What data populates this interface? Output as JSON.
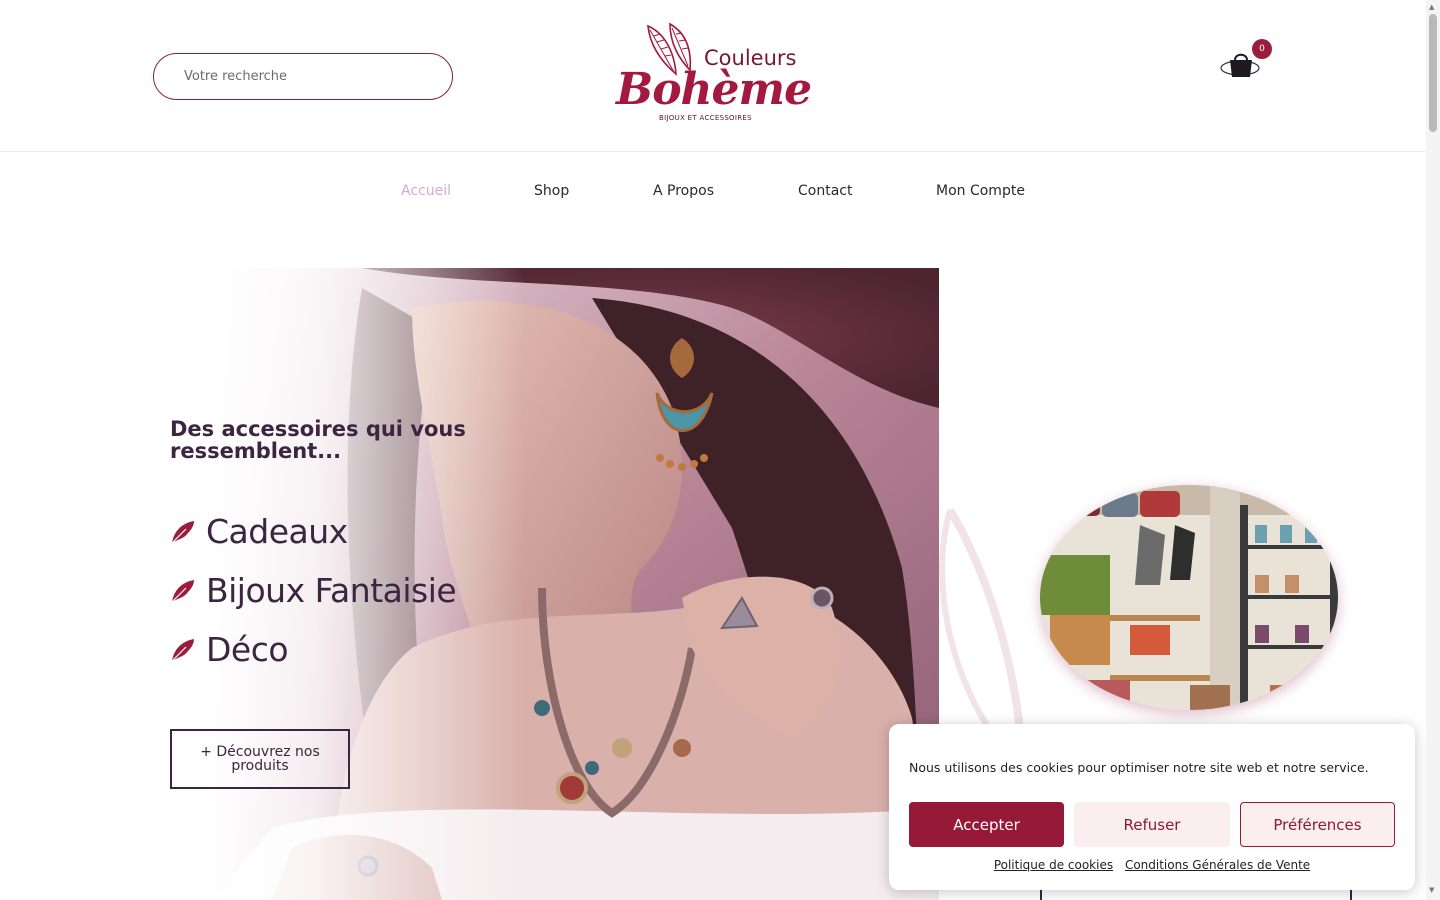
{
  "header": {
    "search_placeholder": "Votre recherche",
    "logo": {
      "line1": "Couleurs",
      "line2": "Bohème",
      "tagline": "BIJOUX ET ACCESSOIRES"
    },
    "cart_count": "0"
  },
  "nav": {
    "items": [
      {
        "label": "Accueil",
        "active": true
      },
      {
        "label": "Shop"
      },
      {
        "label": "A Propos"
      },
      {
        "label": "Contact"
      },
      {
        "label": "Mon Compte"
      }
    ]
  },
  "hero": {
    "title": "Des accessoires qui vous ressemblent...",
    "list": [
      {
        "label": "Cadeaux",
        "icon": "feather-icon"
      },
      {
        "label": "Bijoux Fantaisie",
        "icon": "feather-icon"
      },
      {
        "label": "Déco",
        "icon": "feather-icon"
      }
    ],
    "button_label": "+ Découvrez nos produits"
  },
  "cookie_banner": {
    "text": "Nous utilisons des cookies pour optimiser notre site web et notre service.",
    "accept_label": "Accepter",
    "refuse_label": "Refuser",
    "preferences_label": "Préférences",
    "links": [
      "Politique de cookies",
      "Conditions Générales de Vente"
    ]
  },
  "colors": {
    "brand": "#9b1d3d",
    "text_dark": "#3b2541",
    "nav_active": "#d9a8cf",
    "refuse_bg": "#fbeeee"
  }
}
